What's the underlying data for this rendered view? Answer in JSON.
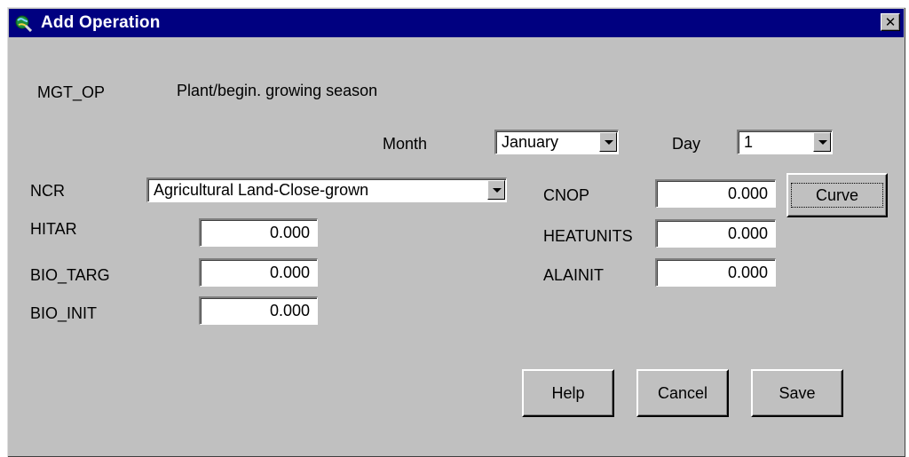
{
  "window": {
    "title": "Add Operation",
    "close_glyph": "✕",
    "icon": "globe-search-icon"
  },
  "mgt_op": {
    "label": "MGT_OP",
    "value": "Plant/begin. growing season"
  },
  "month": {
    "label": "Month",
    "value": "January"
  },
  "day": {
    "label": "Day",
    "value": "1"
  },
  "ncr": {
    "label": "NCR",
    "value": "Agricultural Land-Close-grown"
  },
  "hitar": {
    "label": "HITAR",
    "value": "0.000"
  },
  "bio_targ": {
    "label": "BIO_TARG",
    "value": "0.000"
  },
  "bio_init": {
    "label": "BIO_INIT",
    "value": "0.000"
  },
  "cnop": {
    "label": "CNOP",
    "value": "0.000"
  },
  "heatunits": {
    "label": "HEATUNITS",
    "value": "0.000"
  },
  "alainit": {
    "label": "ALAINIT",
    "value": "0.000"
  },
  "buttons": {
    "curve": "Curve",
    "help": "Help",
    "cancel": "Cancel",
    "save": "Save"
  },
  "colors": {
    "titlebar": "#000080",
    "face": "#c0c0c0"
  }
}
